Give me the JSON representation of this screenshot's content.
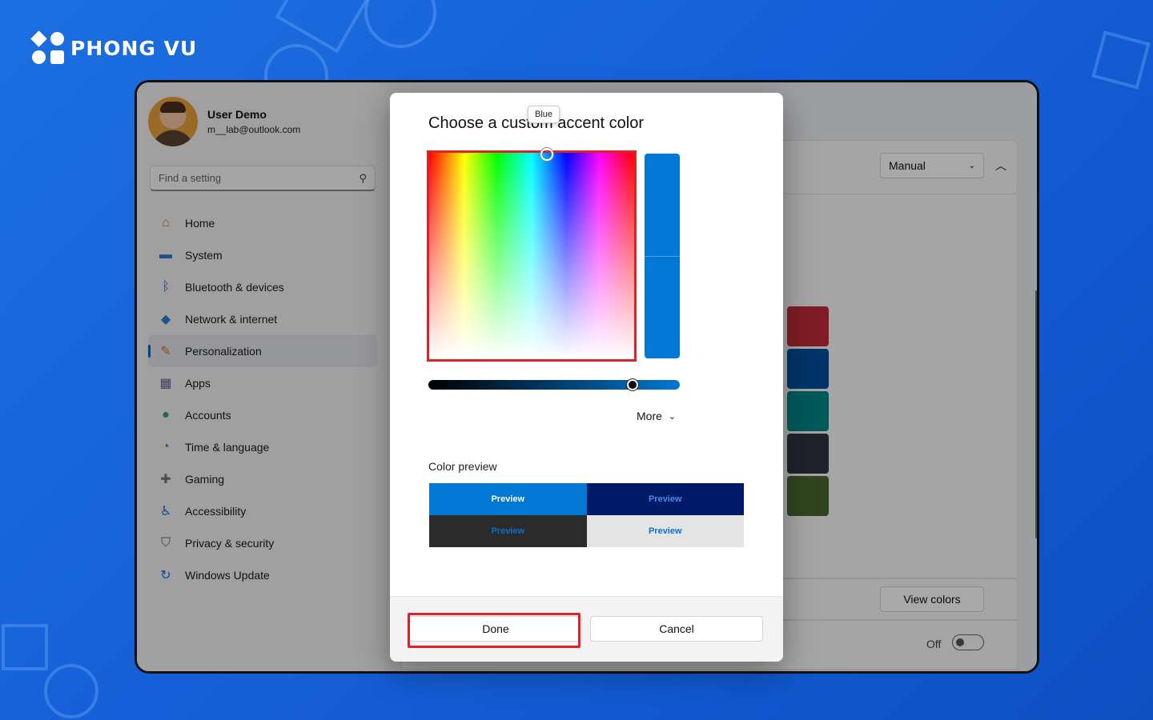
{
  "brand": {
    "name": "PHONG VU"
  },
  "profile": {
    "name": "User Demo",
    "email": "m__lab@outlook.com"
  },
  "search": {
    "placeholder": "Find a setting"
  },
  "sidebar": {
    "items": [
      {
        "label": "Home",
        "icon": "home-icon",
        "color": "#d9743a"
      },
      {
        "label": "System",
        "icon": "system-icon",
        "color": "#2b7bd1"
      },
      {
        "label": "Bluetooth & devices",
        "icon": "bluetooth-icon",
        "color": "#1f6fd6"
      },
      {
        "label": "Network & internet",
        "icon": "wifi-icon",
        "color": "#2a7fd4"
      },
      {
        "label": "Personalization",
        "icon": "brush-icon",
        "color": "#c97a3a",
        "active": true
      },
      {
        "label": "Apps",
        "icon": "apps-icon",
        "color": "#5a6b85"
      },
      {
        "label": "Accounts",
        "icon": "account-icon",
        "color": "#2fa46a"
      },
      {
        "label": "Time & language",
        "icon": "globe-clock-icon",
        "color": "#2c83d0"
      },
      {
        "label": "Gaming",
        "icon": "gamepad-icon",
        "color": "#777777"
      },
      {
        "label": "Accessibility",
        "icon": "accessibility-icon",
        "color": "#1f6fd6"
      },
      {
        "label": "Privacy & security",
        "icon": "shield-icon",
        "color": "#6a6a6a"
      },
      {
        "label": "Windows Update",
        "icon": "update-icon",
        "color": "#1f6fd6"
      }
    ]
  },
  "main": {
    "mode_select": "Manual",
    "view_colors": "View colors",
    "toggle_state": "Off",
    "swatches": [
      "#c42b3a",
      "#0050a0",
      "#00878a",
      "#2f3440",
      "#4a6a30"
    ]
  },
  "dialog": {
    "title": "Choose a custom accent color",
    "tooltip": "Blue",
    "selected_color": "#0078d4",
    "more_label": "More",
    "preview_label": "Color preview",
    "previews": [
      {
        "text": "Preview",
        "bg": "#0078d4",
        "fg": "#ffffff"
      },
      {
        "text": "Preview",
        "bg": "#001a68",
        "fg": "#4a8ee8"
      },
      {
        "text": "Preview",
        "bg": "#2b2b2b",
        "fg": "#0a6fcc"
      },
      {
        "text": "Preview",
        "bg": "#e4e4e4",
        "fg": "#0a6fcc"
      }
    ],
    "done_label": "Done",
    "cancel_label": "Cancel"
  }
}
